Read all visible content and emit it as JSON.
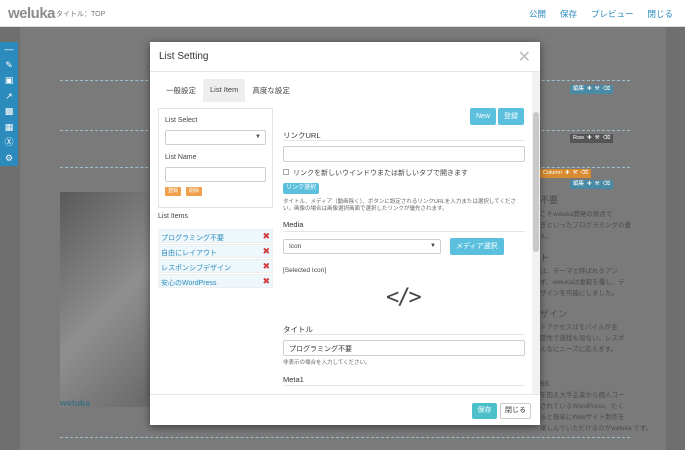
{
  "app": {
    "logo": "weluka",
    "page_title": "タイトル：TOP",
    "nav": [
      "公開",
      "保存",
      "プレビュー",
      "閉じる"
    ]
  },
  "left_tools": [
    "minus-icon",
    "pencil-icon",
    "image-icon",
    "external-link-icon",
    "film-icon",
    "briefcase-icon",
    "wordpress-icon",
    "gear-icon"
  ],
  "background": {
    "row_bar_1": "編集",
    "row_bar_2": "Row",
    "row_bar_3": "Column",
    "row_bar_4": "編集",
    "footer_logo": "weluka",
    "heading_1": "不要",
    "text_1": [
      "こそweluka開発の原点で",
      "ぎといったプログラミングの垂",
      "ん。"
    ],
    "heading_2": "ト",
    "text_2": [
      "は、テーマと呼ばれるアン",
      "ず、welukaは垂範を覆し、テ",
      "ザインを可能にしました。"
    ],
    "heading_3": "ザイン",
    "text_3": [
      "トアクセスはモバイルが主",
      "度性で過程も設ない。レスポ",
      "んなにニーズに応えます。"
    ],
    "heading_4": "ss",
    "text_4": [
      "を抱え大手企業から個人コー",
      "されているWordPress。たく",
      "ると簡単にWebサイト制作を",
      "楽しんでいただけるのがweluka です。"
    ]
  },
  "modal": {
    "title": "List Setting",
    "tabs": [
      "一般設定",
      "List Item",
      "高度な設定"
    ],
    "list_select_label": "List Select",
    "list_name_label": "List Name",
    "register_label": "登録",
    "delete_label": "削除",
    "list_items_label": "List Items",
    "list_items": [
      "プログラミング不要",
      "自由にレイアウト",
      "レスポンシブデザイン",
      "安心のWordPress"
    ],
    "new_label": "New",
    "register_btn": "登録",
    "link_url_label": "リンクURL",
    "link_url_value": "",
    "new_window_label": "リンクを新しいウインドウまたは新しいタブで開きます",
    "link_select_label": "リンク選択",
    "link_help": "タイトル、メディア（動画除く）、ボタンに設定されるリンクURLを入力または選択してください。画像の場合は画像選択画面で選択したリンクが優先されます。",
    "media_label": "Media",
    "media_value": "Icon",
    "media_select_label": "メディア選択",
    "selected_icon_label": "[Selected Icon]",
    "title_label": "タイトル",
    "title_value": "プログラミング不要",
    "title_help": "非表示の場合を入力してください。",
    "meta1_label": "Meta1",
    "save_label": "保存",
    "close_label": "閉じる"
  },
  "colors": {
    "accent": "#2b8bbd",
    "teal": "#5bc0de",
    "save": "#4cc0c9",
    "orange": "#f0a04b",
    "delete": "#d23c3c"
  }
}
